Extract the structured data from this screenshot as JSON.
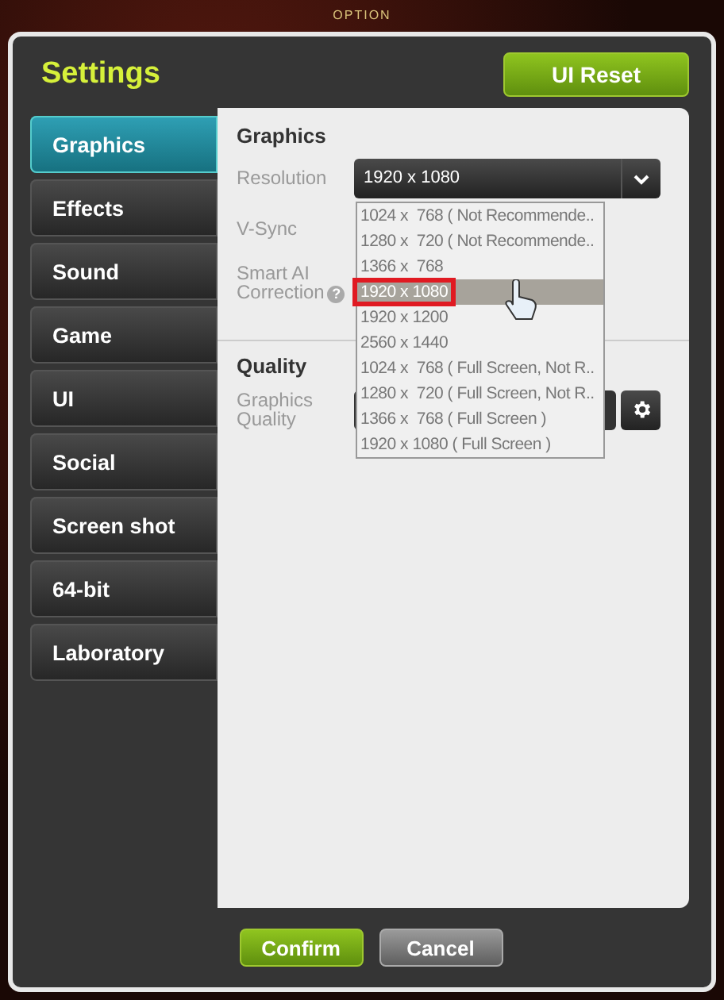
{
  "window": {
    "title": "OPTION"
  },
  "header": {
    "title": "Settings",
    "reset_button": "UI Reset"
  },
  "tabs": [
    {
      "label": "Graphics",
      "selected": true
    },
    {
      "label": "Effects",
      "selected": false
    },
    {
      "label": "Sound",
      "selected": false
    },
    {
      "label": "Game",
      "selected": false
    },
    {
      "label": "UI",
      "selected": false
    },
    {
      "label": "Social",
      "selected": false
    },
    {
      "label": "Screen shot",
      "selected": false
    },
    {
      "label": "64-bit",
      "selected": false
    },
    {
      "label": "Laboratory",
      "selected": false
    }
  ],
  "graphics": {
    "heading": "Graphics",
    "resolution": {
      "label": "Resolution",
      "value": "1920 x 1080",
      "options": [
        {
          "label": "1024 x  768 ( Not Recommende..",
          "selected": false
        },
        {
          "label": "1280 x  720 ( Not Recommende..",
          "selected": false
        },
        {
          "label": "1366 x  768",
          "selected": false
        },
        {
          "label": "1920 x 1080",
          "selected": true
        },
        {
          "label": "1920 x 1200",
          "selected": false
        },
        {
          "label": "2560 x 1440",
          "selected": false
        },
        {
          "label": "1024 x  768 ( Full Screen, Not R..",
          "selected": false
        },
        {
          "label": "1280 x  720 ( Full Screen, Not R..",
          "selected": false
        },
        {
          "label": "1366 x  768 ( Full Screen )",
          "selected": false
        },
        {
          "label": "1920 x 1080 ( Full Screen )",
          "selected": false
        }
      ]
    },
    "vsync": {
      "label": "V-Sync"
    },
    "smart_ai": {
      "label": "Smart AI Correction",
      "help": "?"
    }
  },
  "quality": {
    "heading": "Quality",
    "label": "Graphics Quality"
  },
  "buttons": [
    {
      "label": "Confirm",
      "kind": "primary"
    },
    {
      "label": "Cancel",
      "kind": "secondary"
    }
  ]
}
